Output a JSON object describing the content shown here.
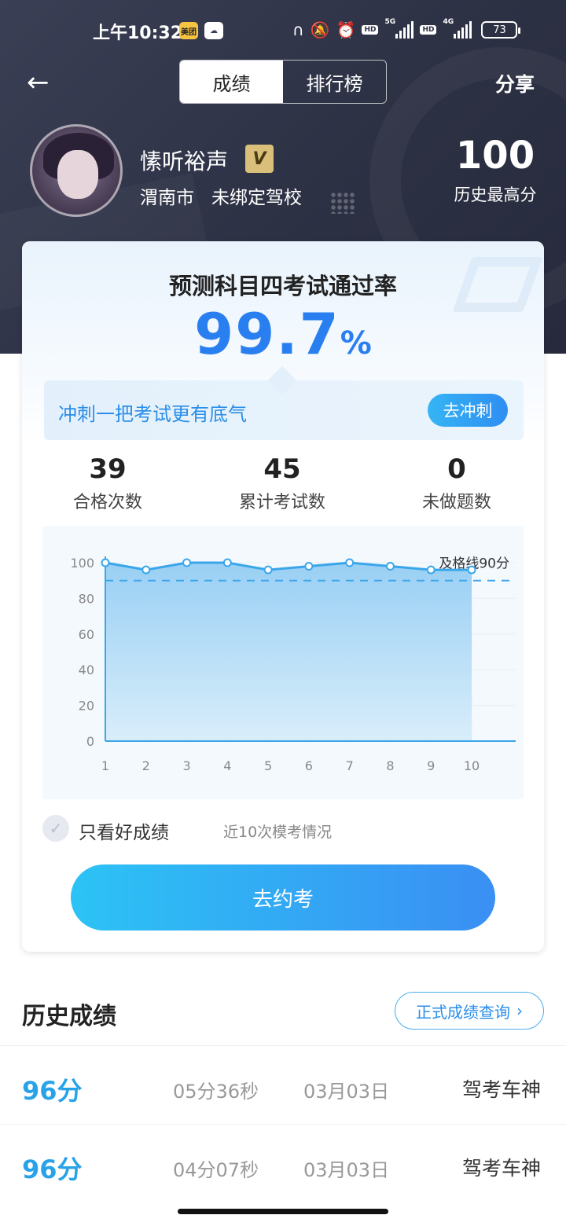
{
  "status_bar": {
    "time": "上午10:32",
    "badge_meituan": "美团",
    "network1": "5G",
    "network2": "4G",
    "hd": "HD",
    "battery": "73"
  },
  "header": {
    "tabs": [
      {
        "label": "成绩",
        "active": true
      },
      {
        "label": "排行榜",
        "active": false
      }
    ],
    "share_label": "分享"
  },
  "profile": {
    "name": "愫听裕声",
    "vip_badge": "V",
    "city": "渭南市",
    "school": "未绑定驾校",
    "best_score": "100",
    "best_score_label": "历史最高分"
  },
  "prediction": {
    "title": "预测科目四考试通过率",
    "value": "99.7",
    "unit": "%",
    "sprint_text": "冲刺一把考试更有底气",
    "sprint_button": "去冲刺"
  },
  "stats": [
    {
      "value": "39",
      "label": "合格次数"
    },
    {
      "value": "45",
      "label": "累计考试数"
    },
    {
      "value": "0",
      "label": "未做题数"
    }
  ],
  "chart_data": {
    "type": "area",
    "x": [
      1,
      2,
      3,
      4,
      5,
      6,
      7,
      8,
      9,
      10
    ],
    "series": [
      {
        "values": [
          100,
          96,
          100,
          100,
          96,
          98,
          100,
          98,
          96,
          96
        ]
      }
    ],
    "ylim": [
      0,
      100
    ],
    "yticks": [
      0,
      20,
      40,
      60,
      80,
      100
    ],
    "pass_line": 90,
    "pass_label": "及格线90分",
    "grid": true,
    "colors": {
      "line": "#3aa6ea",
      "fill": "#bfe0f7",
      "pass": "#3aa6ea"
    }
  },
  "filter": {
    "good_only_label": "只看好成绩",
    "recent_label": "近10次模考情况"
  },
  "book_button": "去约考",
  "history": {
    "title": "历史成绩",
    "query_button": "正式成绩查询",
    "rows": [
      {
        "score": "96分",
        "duration": "05分36秒",
        "date": "03月03日",
        "title": "驾考车神"
      },
      {
        "score": "96分",
        "duration": "04分07秒",
        "date": "03月03日",
        "title": "驾考车神"
      }
    ]
  },
  "icons": {
    "back": "arrow-left-icon",
    "check": "check-icon",
    "chevron": "chevron-right-icon"
  }
}
